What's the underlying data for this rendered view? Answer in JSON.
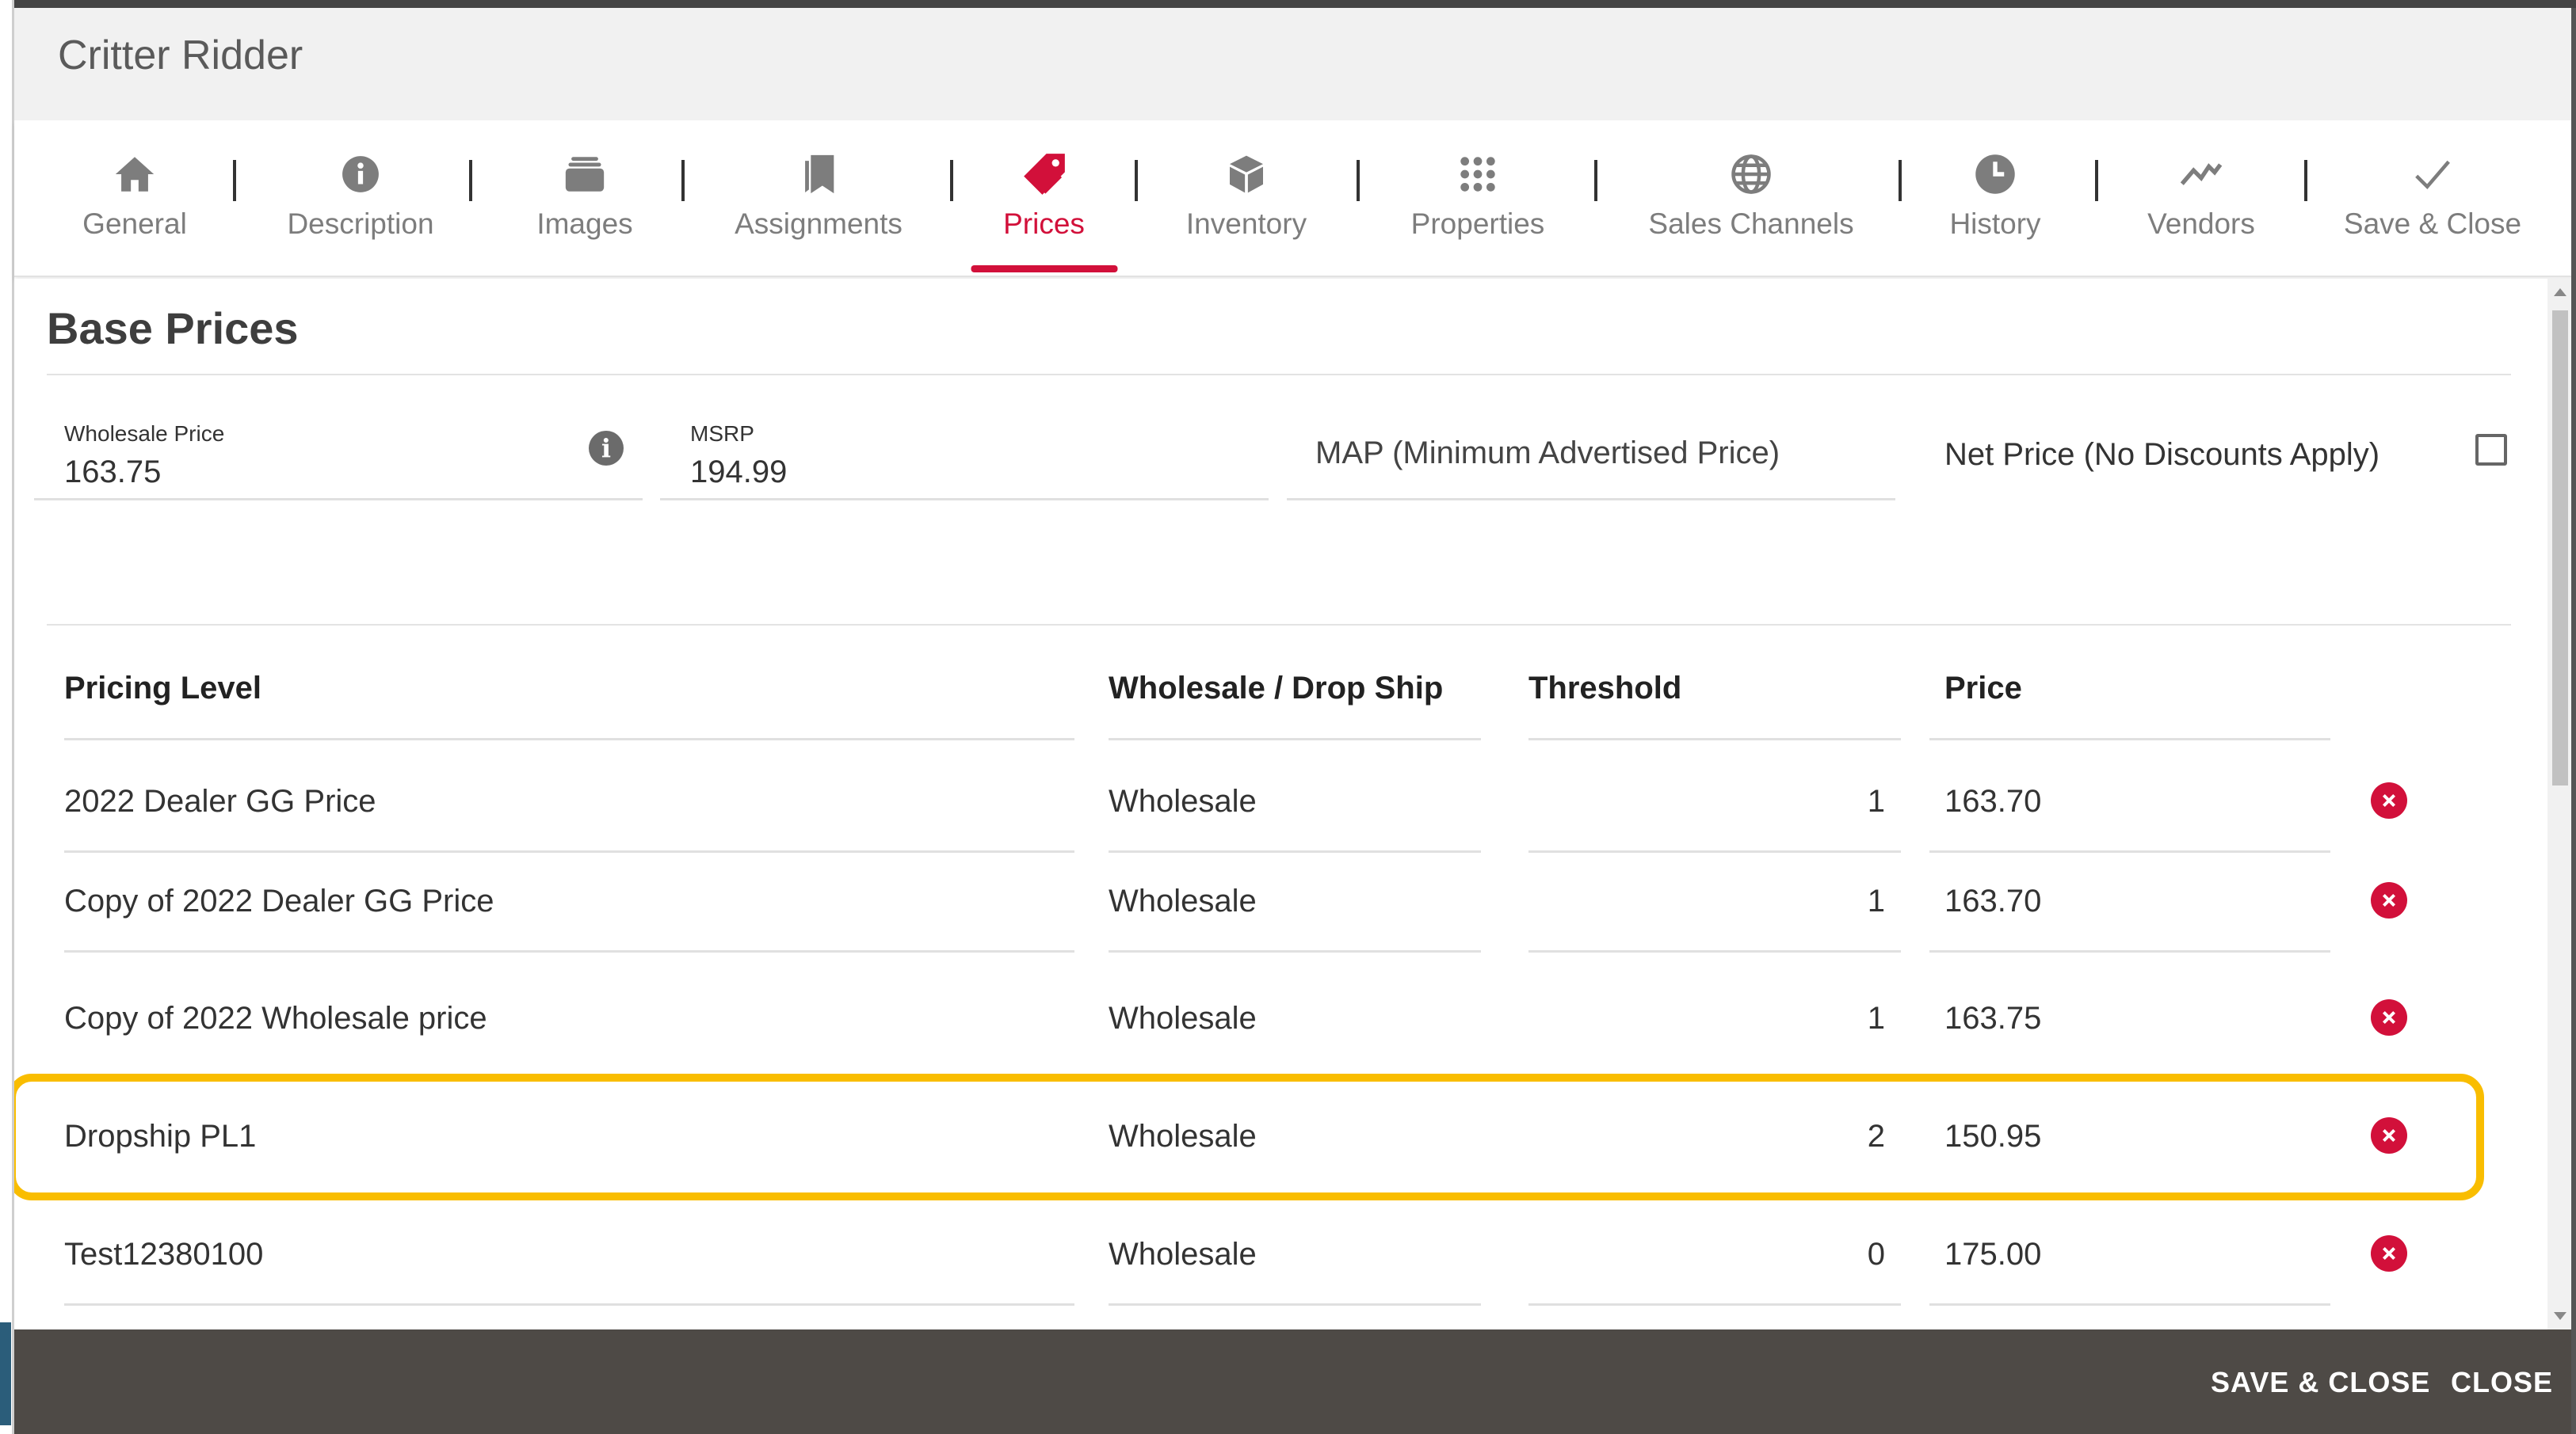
{
  "window": {
    "title": "Critter Ridder"
  },
  "tabs": [
    {
      "id": "general",
      "label": "General",
      "icon": "home-icon",
      "active": false
    },
    {
      "id": "description",
      "label": "Description",
      "icon": "info-icon",
      "active": false
    },
    {
      "id": "images",
      "label": "Images",
      "icon": "images-stack-icon",
      "active": false
    },
    {
      "id": "assignments",
      "label": "Assignments",
      "icon": "bookmark-icon",
      "active": false
    },
    {
      "id": "prices",
      "label": "Prices",
      "icon": "price-tag-icon",
      "active": true
    },
    {
      "id": "inventory",
      "label": "Inventory",
      "icon": "box-icon",
      "active": false
    },
    {
      "id": "properties",
      "label": "Properties",
      "icon": "grid-dots-icon",
      "active": false
    },
    {
      "id": "sales_channels",
      "label": "Sales Channels",
      "icon": "globe-icon",
      "active": false
    },
    {
      "id": "history",
      "label": "History",
      "icon": "clock-icon",
      "active": false
    },
    {
      "id": "vendors",
      "label": "Vendors",
      "icon": "trend-line-icon",
      "active": false
    },
    {
      "id": "save_close",
      "label": "Save & Close",
      "icon": "check-icon",
      "active": false
    }
  ],
  "base_prices": {
    "title": "Base Prices",
    "wholesale_price": {
      "label": "Wholesale Price",
      "value": "163.75"
    },
    "msrp": {
      "label": "MSRP",
      "value": "194.99"
    },
    "map": {
      "placeholder": "MAP (Minimum Advertised Price)"
    },
    "net_price": {
      "label": "Net Price (No Discounts Apply)",
      "checked": false
    }
  },
  "pricing_table": {
    "headers": {
      "level": "Pricing Level",
      "type": "Wholesale / Drop Ship",
      "threshold": "Threshold",
      "price": "Price"
    },
    "rows": [
      {
        "level": "2022 Dealer GG Price",
        "type": "Wholesale",
        "threshold": "1",
        "price": "163.70"
      },
      {
        "level": "Copy of 2022 Dealer GG Price",
        "type": "Wholesale",
        "threshold": "1",
        "price": "163.70"
      },
      {
        "level": "Copy of 2022 Wholesale price",
        "type": "Wholesale",
        "threshold": "1",
        "price": "163.75"
      },
      {
        "level": "Dropship PL1",
        "type": "Wholesale",
        "threshold": "2",
        "price": "150.95",
        "highlighted": true
      },
      {
        "level": "Test12380100",
        "type": "Wholesale",
        "threshold": "0",
        "price": "175.00"
      }
    ]
  },
  "footer": {
    "save_close_label": "SAVE & CLOSE",
    "close_label": "CLOSE"
  },
  "colors": {
    "accent": "#d2103a",
    "highlight": "#f9bd00",
    "footer_bg": "#4e4a46"
  }
}
